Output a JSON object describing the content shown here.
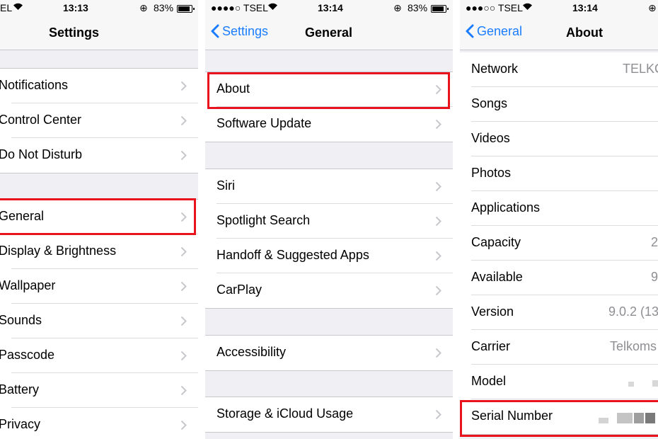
{
  "panel_settings": {
    "status": {
      "left": "EL",
      "time": "13:13",
      "battery": "83%"
    },
    "title": "Settings",
    "groups": [
      {
        "items": [
          {
            "label": "Notifications"
          },
          {
            "label": "Control Center"
          },
          {
            "label": "Do Not Disturb"
          }
        ]
      },
      {
        "items": [
          {
            "label": "General"
          },
          {
            "label": "Display & Brightness"
          },
          {
            "label": "Wallpaper"
          },
          {
            "label": "Sounds"
          },
          {
            "label": "Passcode"
          },
          {
            "label": "Battery"
          },
          {
            "label": "Privacy"
          }
        ]
      }
    ]
  },
  "panel_general": {
    "status": {
      "carrier": "●●●●○ TSEL",
      "time": "13:14",
      "battery": "83%"
    },
    "back": "Settings",
    "title": "General",
    "groups": [
      {
        "items": [
          {
            "label": "About"
          },
          {
            "label": "Software Update"
          }
        ]
      },
      {
        "items": [
          {
            "label": "Siri"
          },
          {
            "label": "Spotlight Search"
          },
          {
            "label": "Handoff & Suggested Apps"
          },
          {
            "label": "CarPlay"
          }
        ]
      },
      {
        "items": [
          {
            "label": "Accessibility"
          }
        ]
      },
      {
        "items": [
          {
            "label": "Storage & iCloud Usage"
          }
        ]
      }
    ]
  },
  "panel_about": {
    "status": {
      "carrier": "●●●○○ TSEL",
      "time": "13:14"
    },
    "back": "General",
    "title": "About",
    "rows": [
      {
        "label": "Network",
        "value": "TELKC"
      },
      {
        "label": "Songs",
        "value": ""
      },
      {
        "label": "Videos",
        "value": ""
      },
      {
        "label": "Photos",
        "value": ""
      },
      {
        "label": "Applications",
        "value": ""
      },
      {
        "label": "Capacity",
        "value": "2"
      },
      {
        "label": "Available",
        "value": "9"
      },
      {
        "label": "Version",
        "value": "9.0.2 (13"
      },
      {
        "label": "Carrier",
        "value": "Telkoms"
      },
      {
        "label": "Model",
        "value": ""
      },
      {
        "label": "Serial Number",
        "value": ""
      }
    ]
  },
  "colors": {
    "highlight": "#e8131c",
    "accent": "#1a7dff",
    "background": "#efeff4"
  }
}
